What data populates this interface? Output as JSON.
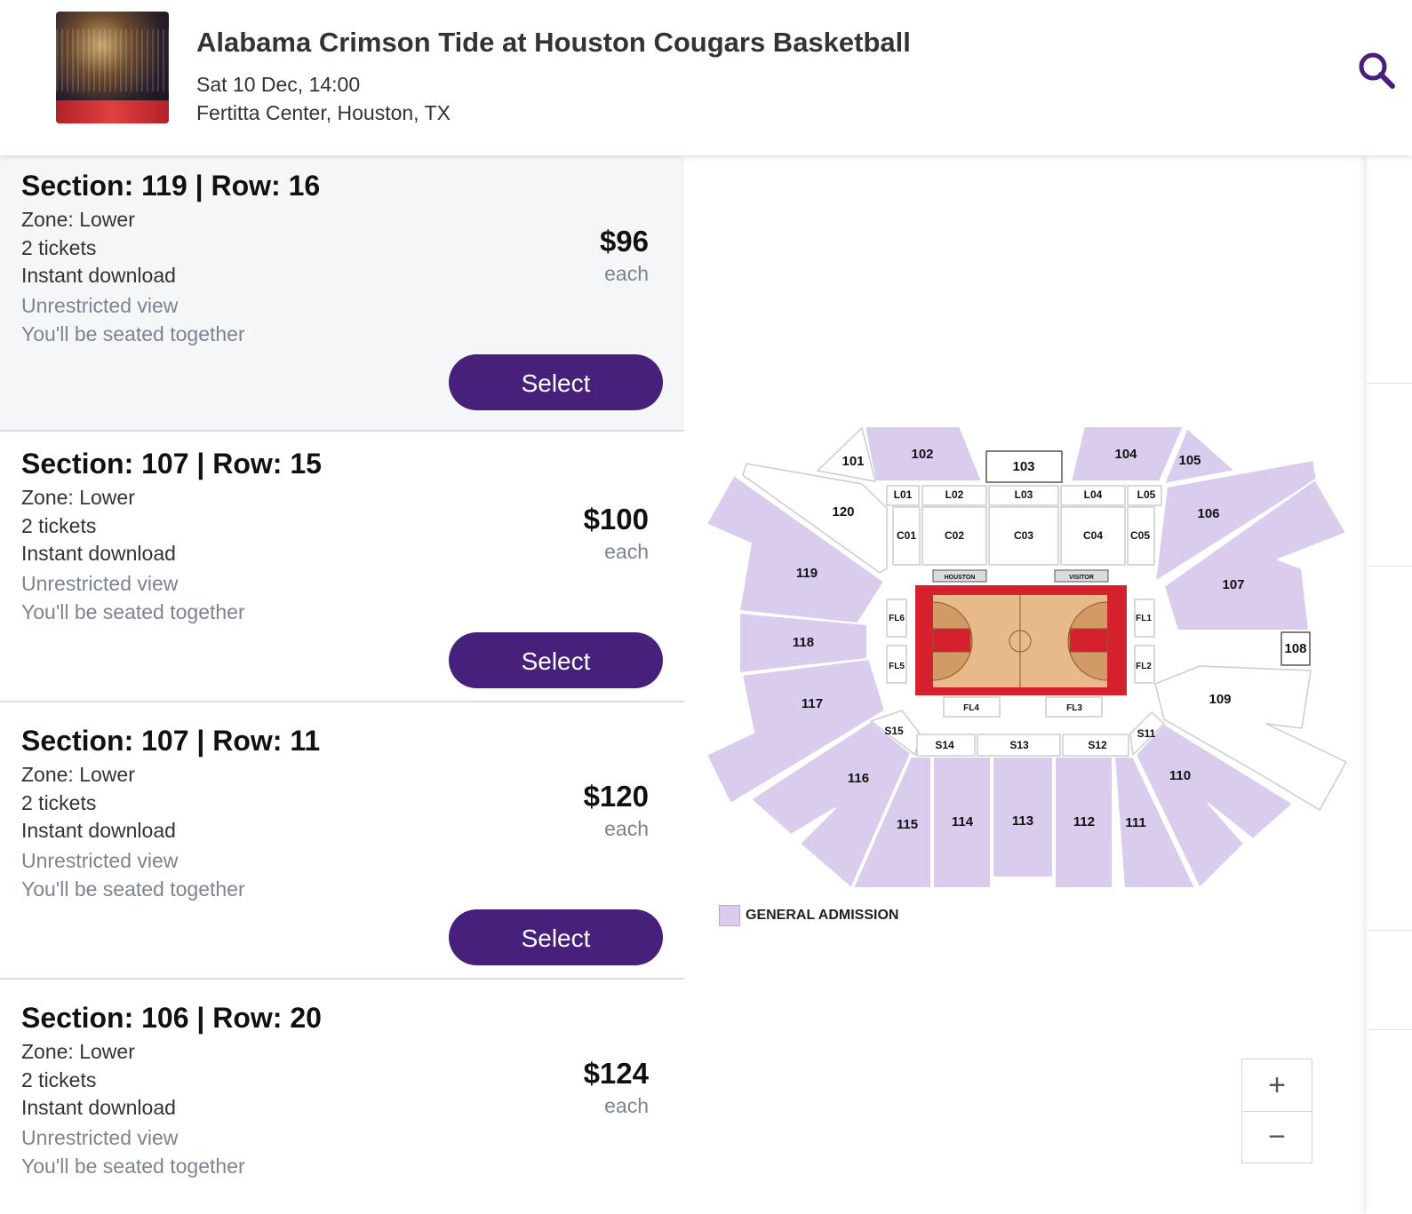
{
  "event": {
    "title": "Alabama Crimson Tide at Houston Cougars Basketball",
    "datetime": "Sat 10 Dec, 14:00",
    "venue": "Fertitta Center, Houston, TX"
  },
  "listings": [
    {
      "section_row": "Section: 119 | Row: 16",
      "zone": "Zone: Lower",
      "tickets": "2 tickets",
      "delivery": "Instant download",
      "view": "Unrestricted view",
      "seating": "You'll be seated together",
      "price": "$96",
      "each": "each",
      "select": "Select"
    },
    {
      "section_row": "Section: 107 | Row: 15",
      "zone": "Zone: Lower",
      "tickets": "2 tickets",
      "delivery": "Instant download",
      "view": "Unrestricted view",
      "seating": "You'll be seated together",
      "price": "$100",
      "each": "each",
      "select": "Select"
    },
    {
      "section_row": "Section: 107 | Row: 11",
      "zone": "Zone: Lower",
      "tickets": "2 tickets",
      "delivery": "Instant download",
      "view": "Unrestricted view",
      "seating": "You'll be seated together",
      "price": "$120",
      "each": "each",
      "select": "Select"
    },
    {
      "section_row": "Section: 106 | Row: 20",
      "zone": "Zone: Lower",
      "tickets": "2 tickets",
      "delivery": "Instant download",
      "view": "Unrestricted view",
      "seating": "You'll be seated together",
      "price": "$124",
      "each": "each",
      "select": "Select"
    }
  ],
  "map": {
    "sections": [
      "101",
      "102",
      "103",
      "104",
      "105",
      "106",
      "107",
      "108",
      "109",
      "110",
      "111",
      "112",
      "113",
      "114",
      "115",
      "116",
      "117",
      "118",
      "119",
      "120"
    ],
    "loge": [
      "L01",
      "L02",
      "L03",
      "L04",
      "L05"
    ],
    "courtside": [
      "C01",
      "C02",
      "C03",
      "C04",
      "C05"
    ],
    "floor": [
      "FL1",
      "FL2",
      "FL3",
      "FL4",
      "FL5",
      "FL6"
    ],
    "student": [
      "S11",
      "S12",
      "S13",
      "S14",
      "S15"
    ],
    "benches": [
      "HOUSTON",
      "VISITOR"
    ],
    "legend": "GENERAL ADMISSION",
    "zoom_in": "+",
    "zoom_out": "−"
  },
  "colors": {
    "accent": "#46207a",
    "general_admission": "#d9ccec",
    "court_border": "#d5202e",
    "court_wood": "#e8b98a"
  }
}
